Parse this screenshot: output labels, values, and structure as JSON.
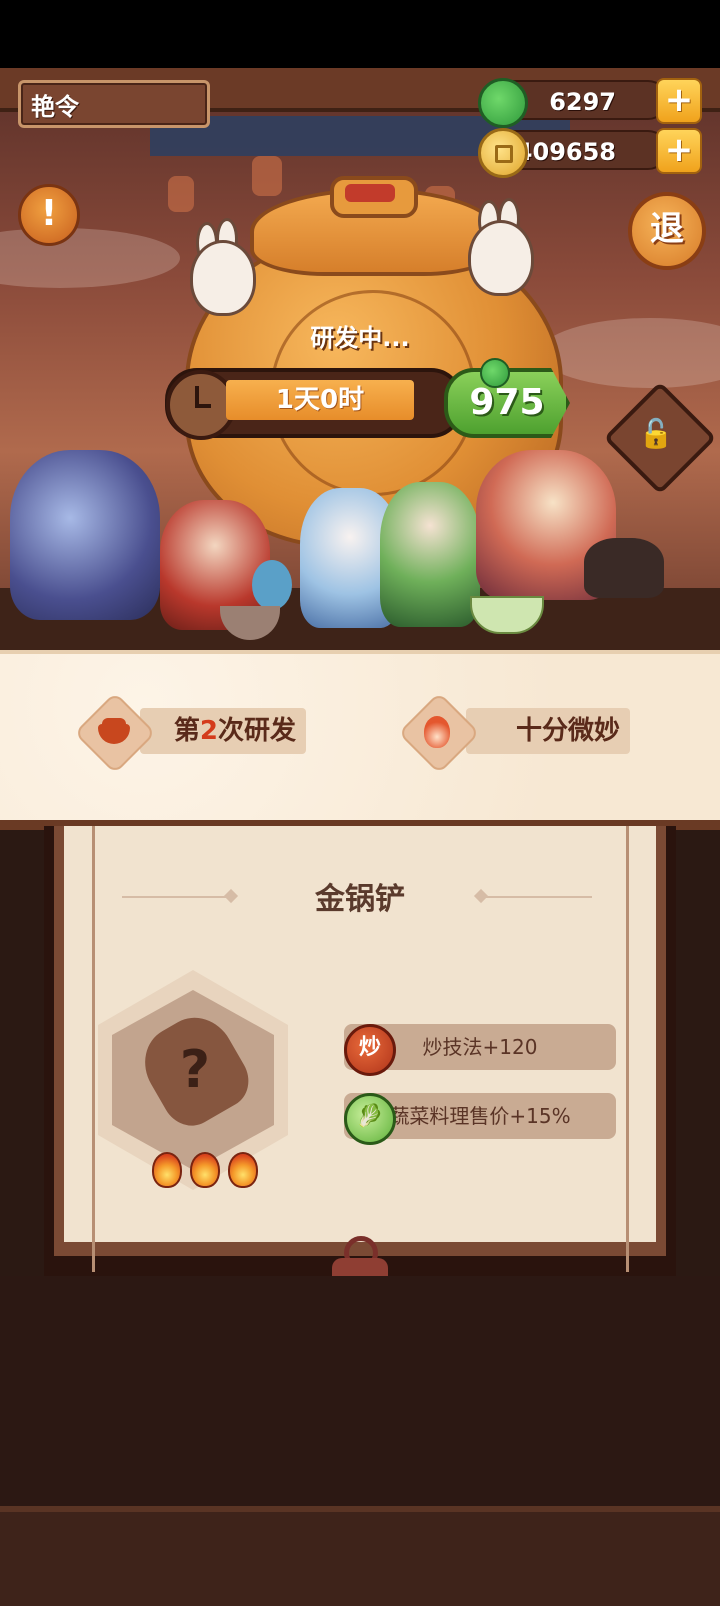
{
  "header": {
    "title": "艳令",
    "jade_amount": "6297",
    "coin_amount": "3409658",
    "plus_label": "+"
  },
  "controls": {
    "alert_label": "!",
    "exit_label": "退"
  },
  "research": {
    "status_text": "研发中...",
    "timer_text": "1天0时",
    "speedup_cost": "975",
    "lock_glyph": "🔓"
  },
  "info": {
    "research_count_prefix": "第",
    "research_count_number": "2",
    "research_count_suffix": "次研发",
    "quality_label": "十分微妙"
  },
  "item": {
    "name": "金锅铲",
    "unknown_glyph": "?",
    "flame_count": 3,
    "attributes": [
      {
        "icon_label": "炒",
        "text": "炒技法+120"
      },
      {
        "icon_label": "🥬",
        "text": "蔬菜料理售价+15%"
      }
    ]
  },
  "colors": {
    "accent_orange": "#e78d2a",
    "speedup_green": "#4ea12f",
    "research_count_red": "#d43a1a"
  }
}
